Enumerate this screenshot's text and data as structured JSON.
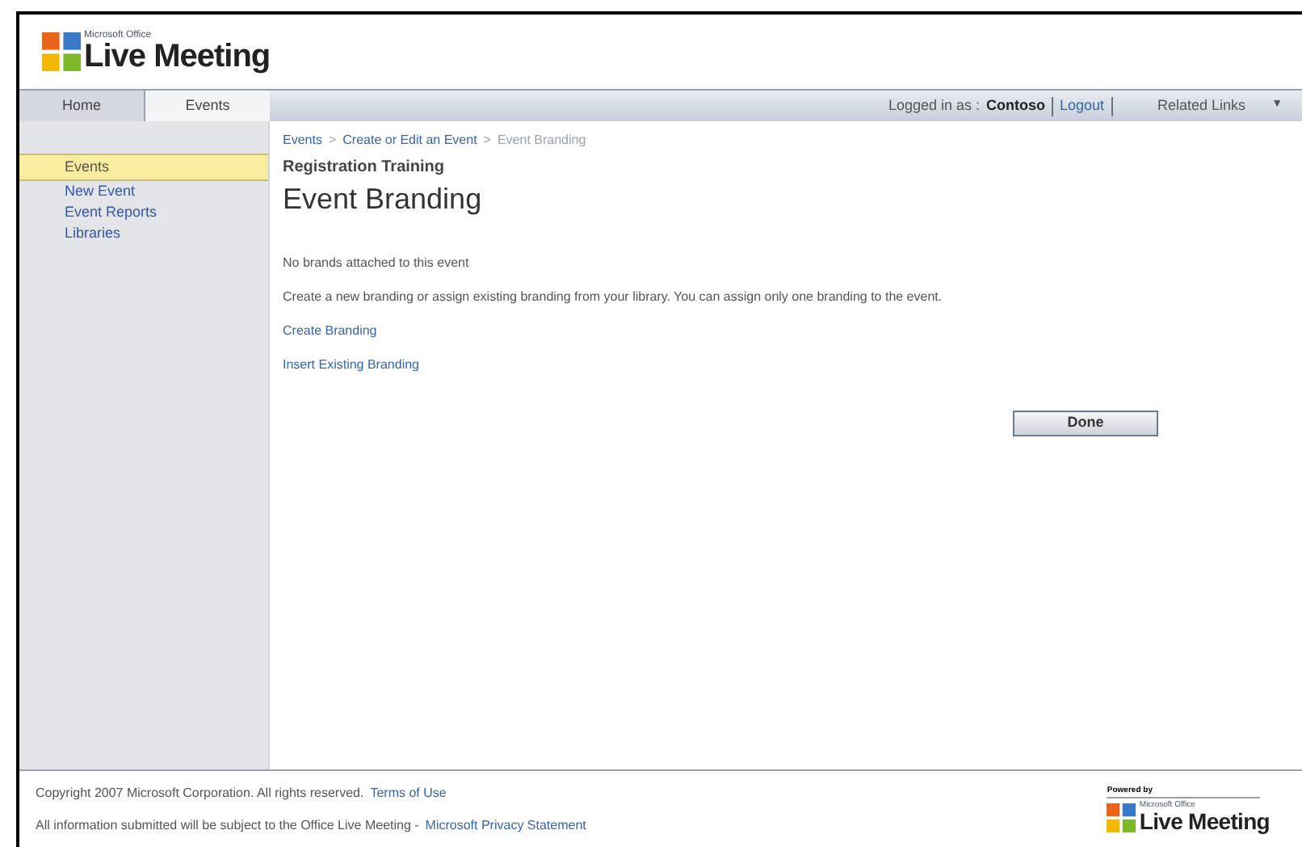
{
  "header": {
    "logo_small": "Microsoft Office",
    "logo_text": "Live Meeting"
  },
  "tabs": [
    {
      "label": "Home",
      "selected": false
    },
    {
      "label": "Events",
      "selected": true
    }
  ],
  "user_bar": {
    "prefix": "Logged in as :",
    "user": "Contoso",
    "logout": "Logout",
    "related": "Related Links",
    "caret": "▼"
  },
  "sidebar": {
    "items": [
      {
        "label": "Events",
        "selected": true
      },
      {
        "label": "New Event",
        "selected": false
      },
      {
        "label": "Event Reports",
        "selected": false
      },
      {
        "label": "Libraries",
        "selected": false
      }
    ]
  },
  "breadcrumb": [
    {
      "label": "Events",
      "current": false
    },
    {
      "label": "Create or Edit an Event",
      "current": false
    },
    {
      "label": "Event Branding",
      "current": true
    }
  ],
  "breadcrumb_separator": ">",
  "subtitle": "Registration Training",
  "title": "Event Branding",
  "status": "No brands attached to this event",
  "description": "Create a new branding or assign existing branding from your library. You can assign only one branding to the event.",
  "links": [
    "Create Branding",
    "Insert Existing Branding"
  ],
  "done_button": "Done",
  "footer": {
    "copyright": "Copyright 2007 Microsoft Corporation. All rights reserved.",
    "terms": "Terms of Use",
    "notice": "All information submitted will be subject to the Office Live Meeting -",
    "privacy": "Microsoft Privacy Statement",
    "powered": "Powered by",
    "logo_small": "Microsoft Office",
    "logo_text": "Live Meeting"
  }
}
